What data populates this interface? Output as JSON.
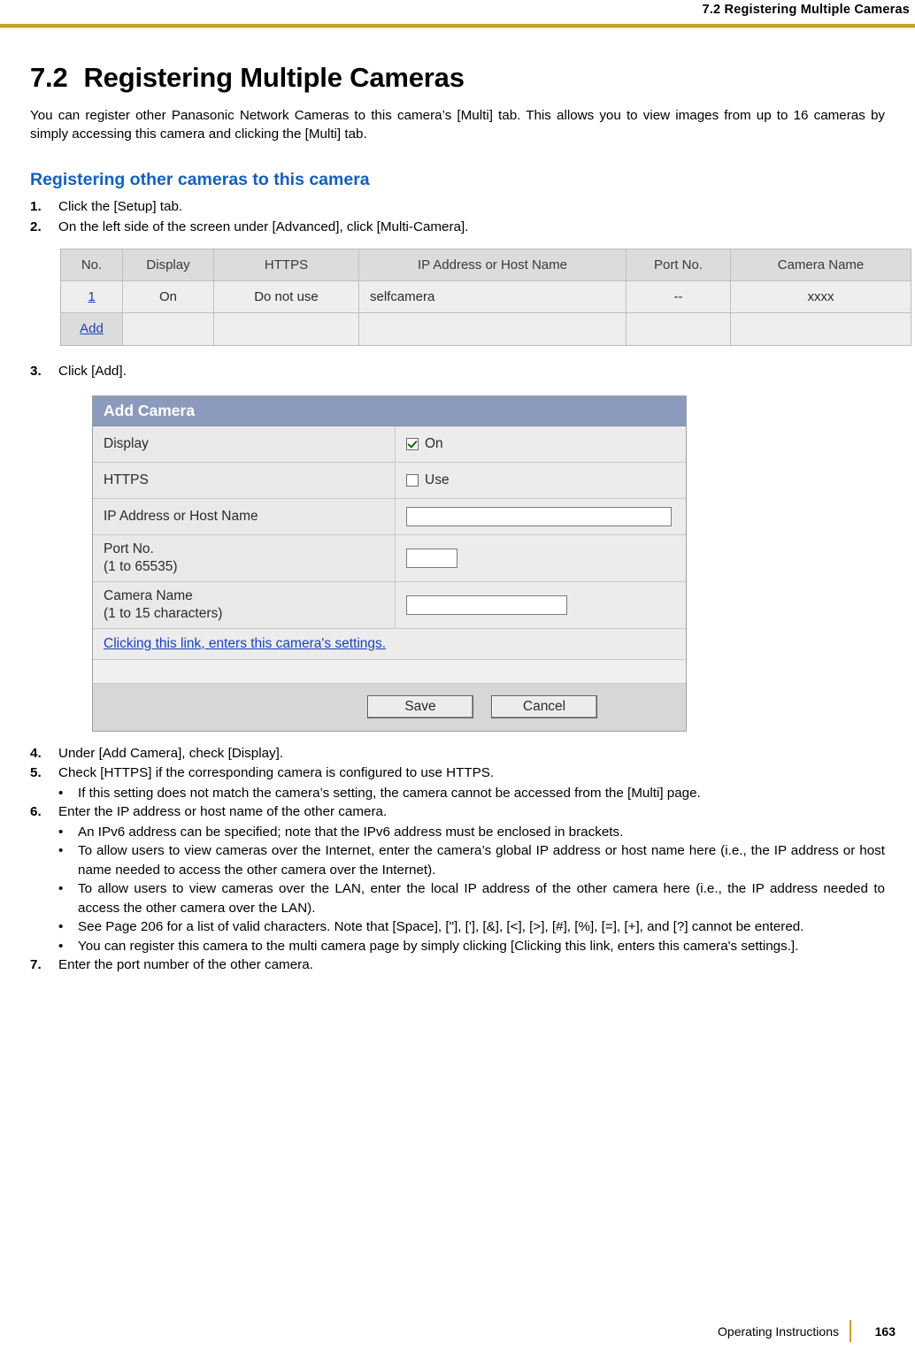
{
  "header": {
    "running_head": "7.2 Registering Multiple Cameras"
  },
  "chapter": {
    "number": "7.2",
    "title": "Registering Multiple Cameras",
    "intro": "You can register other Panasonic Network Cameras to this camera’s [Multi] tab. This allows you to view images from up to 16 cameras by simply accessing this camera and clicking the [Multi] tab."
  },
  "section": {
    "title": "Registering other cameras to this camera"
  },
  "steps": [
    {
      "n": "1.",
      "text": "Click the [Setup] tab."
    },
    {
      "n": "2.",
      "text": "On the left side of the screen under [Advanced], click [Multi-Camera]."
    },
    {
      "n": "3.",
      "text": "Click [Add]."
    },
    {
      "n": "4.",
      "text": "Under [Add Camera], check [Display]."
    },
    {
      "n": "5.",
      "text": "Check [HTTPS] if the corresponding camera is configured to use HTTPS."
    },
    {
      "n": "6.",
      "text": "Enter the IP address or host name of the other camera."
    },
    {
      "n": "7.",
      "text": "Enter the port number of the other camera."
    }
  ],
  "bullets": {
    "b5_1": "If this setting does not match the camera’s setting, the camera cannot be accessed from the [Multi] page.",
    "b6_1": "An IPv6 address can be specified; note that the IPv6 address must be enclosed in brackets.",
    "b6_2": "To allow users to view cameras over the Internet, enter the camera’s global IP address or host name here (i.e., the IP address or host name needed to access the other camera over the Internet).",
    "b6_3": "To allow users to view cameras over the LAN, enter the local IP address of the other camera here (i.e., the IP address needed to access the other camera over the LAN).",
    "b6_4": "See Page 206 for a list of valid characters. Note that [Space], [\"], ['], [&], [<], [>], [#], [%], [=], [+], and [?] cannot be entered.",
    "b6_5": "You can register this camera to the multi camera page by simply clicking [Clicking this link, enters this camera's settings.]."
  },
  "figure_multicamera_table": {
    "headers": [
      "No.",
      "Display",
      "HTTPS",
      "IP Address or Host Name",
      "Port No.",
      "Camera Name"
    ],
    "rows": [
      {
        "no": "1",
        "display": "On",
        "https": "Do not use",
        "address": "selfcamera",
        "port": "--",
        "name": "xxxx"
      }
    ],
    "add_label": "Add"
  },
  "figure_add_camera": {
    "title": "Add Camera",
    "rows": [
      {
        "label": "Display",
        "value": "On",
        "checked": true
      },
      {
        "label": "HTTPS",
        "value": "Use",
        "checked": false
      },
      {
        "label": "IP Address or Host Name",
        "value": ""
      },
      {
        "label_line1": "Port No.",
        "label_line2": "(1 to 65535)",
        "value": ""
      },
      {
        "label_line1": "Camera Name",
        "label_line2": "(1 to 15 characters)",
        "value": ""
      }
    ],
    "self_link": "Clicking this link, enters this camera's settings.",
    "save_label": "Save",
    "cancel_label": "Cancel"
  },
  "footer": {
    "left": "Operating Instructions",
    "page": "163"
  },
  "colors": {
    "accent_rule": "#c9a227",
    "section_heading": "#1060c0",
    "link": "#1a3fbf",
    "panel_titlebar": "#8c9bbd"
  }
}
